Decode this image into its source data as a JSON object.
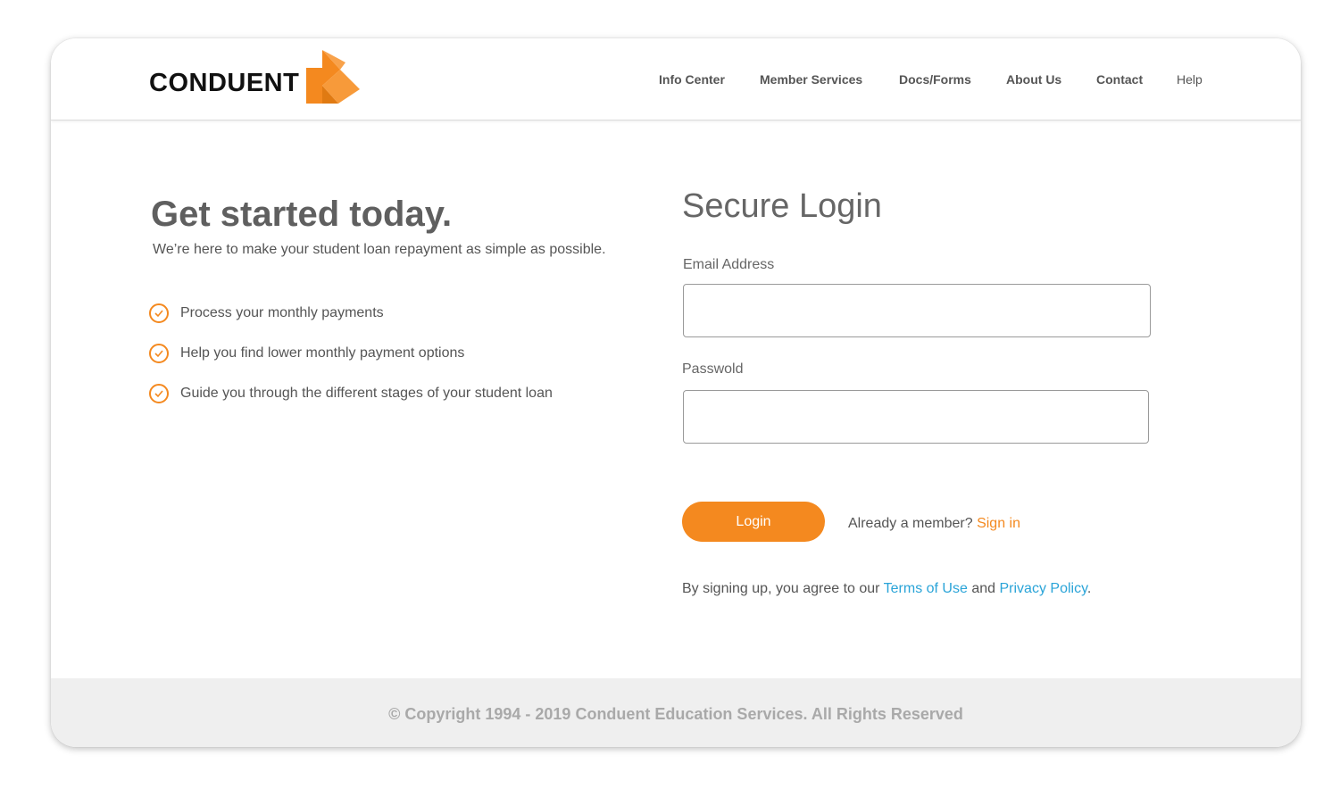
{
  "brand": {
    "name": "CONDUENT",
    "accent": "#f4891f",
    "link_color": "#2aa4d8"
  },
  "nav": {
    "items": [
      {
        "label": "Info Center"
      },
      {
        "label": "Member Services"
      },
      {
        "label": "Docs/Forms"
      },
      {
        "label": "About Us"
      },
      {
        "label": "Contact"
      },
      {
        "label": "Help"
      }
    ]
  },
  "intro": {
    "headline": "Get started today.",
    "subhead": "We’re here to make your student loan repayment as simple as possible.",
    "features": [
      {
        "text": "Process your monthly payments",
        "icon": "check-circle-icon"
      },
      {
        "text": "Help you find lower monthly payment options",
        "icon": "check-circle-icon"
      },
      {
        "text": "Guide you through the different stages of your student loan",
        "icon": "check-circle-icon"
      }
    ]
  },
  "login": {
    "title": "Secure Login",
    "email_label": "Email Address",
    "email_value": "",
    "password_label": "Passwold",
    "password_value": "",
    "button_label": "Login",
    "member_prompt": "Already a member?",
    "sign_in_label": "Sign in",
    "agree_prefix": "By signing up, you agree to our",
    "terms_label": "Terms of Use",
    "and_text": "and",
    "privacy_label": "Privacy Policy",
    "agree_suffix": "."
  },
  "footer": {
    "copyright": "© Copyright 1994 - 2019 Conduent Education Services. All Rights Reserved"
  }
}
